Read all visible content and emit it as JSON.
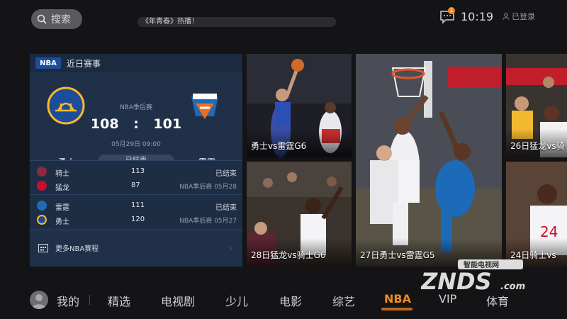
{
  "header": {
    "search_label": "搜索",
    "ticker_text": "《年青春》热播！",
    "message_badge": "1",
    "time": "10:19",
    "login_label": "已登录"
  },
  "panel": {
    "title": "近日赛事",
    "logo_text": "NBA",
    "featured": {
      "stage": "NBA季后赛",
      "home_score": "108",
      "separator": ":",
      "away_score": "101",
      "date": "05月29日 09:00",
      "home_team": "勇士",
      "away_team": "雷霆",
      "status": "已结束"
    },
    "games": [
      {
        "teams": [
          {
            "name": "骑士",
            "score": "113",
            "info": "已结束",
            "color": "#8a2a3c"
          },
          {
            "name": "猛龙",
            "score": "87",
            "info": "NBA季后赛 05月28",
            "color": "#c8102e"
          }
        ]
      },
      {
        "teams": [
          {
            "name": "雷霆",
            "score": "111",
            "info": "已结束",
            "color": "#1d6ab8"
          },
          {
            "name": "勇士",
            "score": "120",
            "info": "NBA季后赛 05月27",
            "color": "#1d4c9a"
          }
        ]
      }
    ],
    "more_label": "更多NBA赛程"
  },
  "tiles": [
    {
      "caption": "勇士vs雷霆G6"
    },
    {
      "caption": "27日勇士vs雷霆G5"
    },
    {
      "caption": "26日猛龙vs骑"
    },
    {
      "caption": "28日猛龙vs骑士G6"
    },
    {
      "caption": "24日骑士vs"
    }
  ],
  "nav": {
    "items": [
      "我的",
      "精选",
      "电视剧",
      "少儿",
      "电影",
      "综艺",
      "NBA",
      "VIP",
      "体育"
    ],
    "active": "NBA"
  },
  "watermark": {
    "line1": "智能电视网",
    "line2": "ZNDS",
    "line3": ".com"
  },
  "colors": {
    "accent": "#f08a24",
    "panel": "#1f3048",
    "warriors_blue": "#1d4c9a",
    "warriors_gold": "#fdb927",
    "thunder_blue": "#1d6ab8",
    "thunder_orange": "#ef6c23"
  }
}
